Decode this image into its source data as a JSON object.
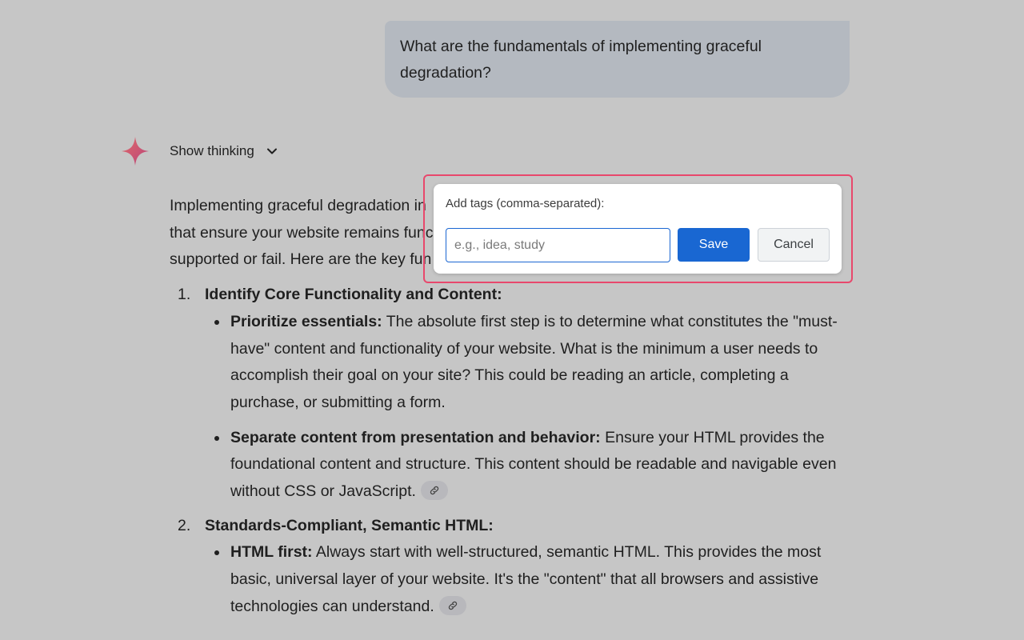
{
  "user_message": {
    "line1": "What are the fundamentals of implementing graceful",
    "line2": "degradation?"
  },
  "assistant": {
    "icon": "sparkle-icon",
    "show_thinking_label": "Show thinking",
    "intro_lines": [
      "Implementing graceful degradation in",
      "that ensure your website remains func",
      "supported or fail. Here are the key fun"
    ],
    "sections": [
      {
        "number": "1.",
        "heading": "Identify Core Functionality and Content:",
        "bullets": [
          {
            "bold": "Prioritize essentials:",
            "text": " The absolute first step is to determine what constitutes the \"must-have\" content and functionality of your website. What is the minimum a user needs to accomplish their goal on your site? This could be reading an article, completing a purchase, or submitting a form."
          },
          {
            "bold": "Separate content from presentation and behavior:",
            "text": " Ensure your HTML provides the foundational content and structure. This content should be readable and navigable even without CSS or JavaScript."
          }
        ]
      },
      {
        "number": "2.",
        "heading": "Standards-Compliant, Semantic HTML:",
        "bullets": [
          {
            "bold": "HTML first:",
            "text": " Always start with well-structured, semantic HTML. This provides the most basic, universal layer of your website. It's the \"content\" that all browsers and assistive technologies can understand."
          }
        ]
      }
    ]
  },
  "tag_dialog": {
    "title": "Add tags (comma-separated):",
    "input_value": "",
    "input_placeholder": "e.g., idea, study",
    "save_label": "Save",
    "cancel_label": "Cancel"
  },
  "colors": {
    "background": "#c6c6c6",
    "user_bubble": "#b4b9c0",
    "primary_button": "#1967d2",
    "highlight_outline": "#e8486c",
    "sparkle": "#d4576a"
  }
}
